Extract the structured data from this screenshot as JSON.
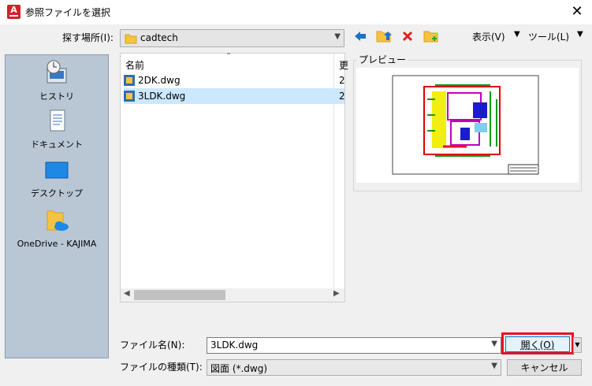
{
  "window": {
    "title": "参照ファイルを選択",
    "close_glyph": "✕",
    "app_icon": "autocad-app-icon"
  },
  "lookin": {
    "label": "探す場所(I):",
    "value": "cadtech"
  },
  "toolbar": {
    "back_icon": "back-arrow-icon",
    "up_icon": "up-folder-icon",
    "delete_icon": "delete-icon",
    "newfolder_icon": "new-folder-icon",
    "view_label": "表示(V)",
    "tools_label": "ツール(L)"
  },
  "places": [
    {
      "label": "ヒストリ",
      "icon": "history-icon"
    },
    {
      "label": "ドキュメント",
      "icon": "documents-icon"
    },
    {
      "label": "デスクトップ",
      "icon": "desktop-icon"
    },
    {
      "label": "OneDrive - KAJIMA",
      "icon": "onedrive-icon"
    }
  ],
  "filelist": {
    "name_header": "名前",
    "files": [
      {
        "name": "2DK.dwg",
        "col2": "2",
        "selected": false
      },
      {
        "name": "3LDK.dwg",
        "col2": "2",
        "selected": true
      }
    ],
    "col2_header": "更"
  },
  "preview": {
    "label": "プレビュー"
  },
  "filename": {
    "label": "ファイル名(N):",
    "value": "3LDK.dwg"
  },
  "filetype": {
    "label": "ファイルの種類(T):",
    "value": "図面 (*.dwg)"
  },
  "buttons": {
    "open": "開く(O)",
    "cancel": "キャンセル"
  },
  "colors": {
    "accent": "#0078d7",
    "highlight": "#e81123",
    "places_bg": "#b9c7d5"
  }
}
